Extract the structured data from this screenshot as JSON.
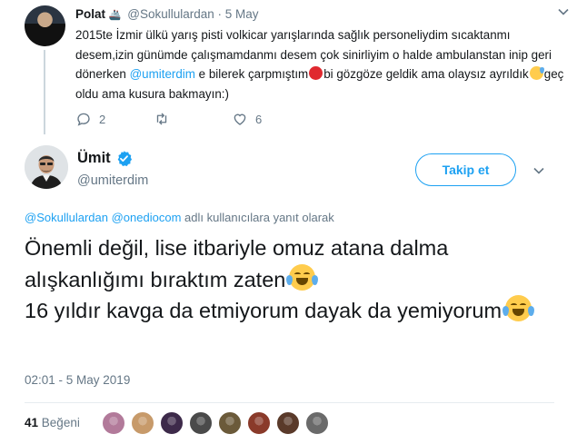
{
  "parent_tweet": {
    "name": "Polat",
    "handle": "@Sokullulardan",
    "separator": "·",
    "date": "5 May",
    "text_segments": [
      {
        "t": "2015te İzmir ülkü yarış pisti volkicar yarışlarında sağlık personeliydim sıcaktanmı desem,izin günümde çalışmamdanmı desem çok sinirliyim o halde ambulanstan inip geri dönerken ",
        "mention": false
      },
      {
        "t": "@umiterdim",
        "mention": true
      },
      {
        "t": " e bilerek çarpmıştım",
        "mention": false
      },
      {
        "t": "bi gözgöze geldik ama olaysız ayrıldık",
        "mention": false
      },
      {
        "t": "geç oldu ama kusura bakmayın:)",
        "mention": false
      }
    ],
    "emojis": [
      "angry-face-emoji",
      "sweat-smile-emoji"
    ],
    "reply_count": "2",
    "retweet_count": "",
    "like_count": "6"
  },
  "main_tweet": {
    "name": "Ümit",
    "handle": "@umiterdim",
    "follow_label": "Takip et",
    "reply_to": {
      "mention1": "@Sokullulardan",
      "mention2": "@onediocom",
      "suffix": " adlı kullanıcılara yanıt olarak"
    },
    "text_line1": "Önemli değil, lise itbariyle omuz atana dalma alışkanlığımı bıraktım zaten",
    "text_line2": "16 yıldır kavga da etmiyorum dayak da yemiyorum",
    "timestamp": "02:01 - 5 May 2019",
    "like_count": "41",
    "like_label": "Beğeni",
    "liker_colors": [
      "#b27a9a",
      "#c79a6a",
      "#3d2a4a",
      "#4a4a4a",
      "#6b5a3a",
      "#8a3a2a",
      "#5a3a2a",
      "#6a6a6a"
    ]
  },
  "colors": {
    "accent": "#1da1f2",
    "muted": "#657786",
    "verified": "#1da1f2",
    "like_heart": "#657786"
  }
}
